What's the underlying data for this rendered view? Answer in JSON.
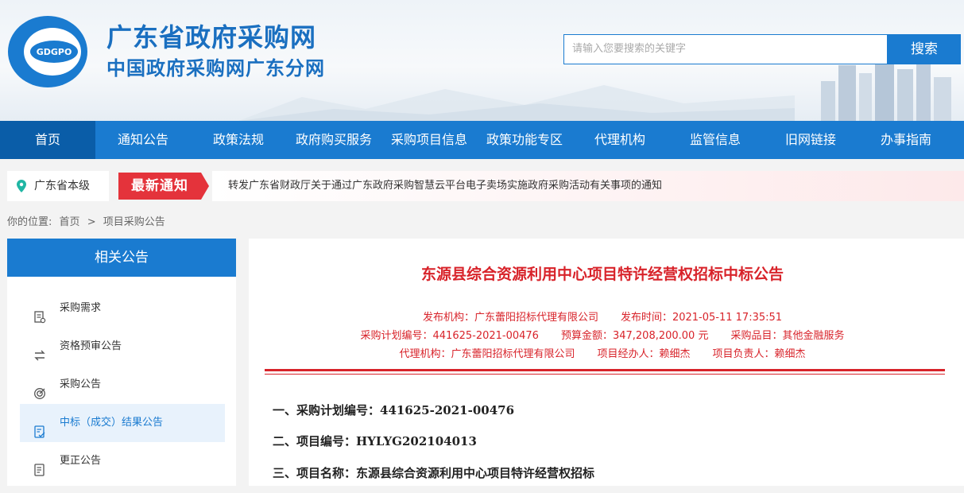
{
  "header": {
    "site_title": "广东省政府采购网",
    "site_subtitle": "中国政府采购网广东分网",
    "logo_text": "GDGPO",
    "search_placeholder": "请输入您要搜索的关键字",
    "search_button": "搜索"
  },
  "nav": {
    "items": [
      "首页",
      "通知公告",
      "政策法规",
      "政府购买服务",
      "采购项目信息",
      "政策功能专区",
      "代理机构",
      "监管信息",
      "旧网链接",
      "办事指南"
    ],
    "active_index": 0
  },
  "notice": {
    "location": "广东省本级",
    "badge": "最新通知",
    "text": "转发广东省财政厅关于通过广东政府采购智慧云平台电子卖场实施政府采购活动有关事项的通知"
  },
  "breadcrumb": {
    "prefix": "你的位置:",
    "home": "首页",
    "sep": ">",
    "current": "项目采购公告"
  },
  "sidebar": {
    "title": "相关公告",
    "items": [
      {
        "label": "采购需求",
        "icon": "document-list-icon"
      },
      {
        "label": "资格预审公告",
        "icon": "swap-arrows-icon"
      },
      {
        "label": "采购公告",
        "icon": "target-icon"
      },
      {
        "label": "中标（成交）结果公告",
        "icon": "document-check-icon"
      },
      {
        "label": "更正公告",
        "icon": "document-edit-icon"
      }
    ],
    "active_index": 3
  },
  "article": {
    "title": "东源县综合资源利用中心项目特许经营权招标中标公告",
    "meta1": [
      "发布机构：广东蕾阳招标代理有限公司",
      "发布时间：2021-05-11 17:35:51"
    ],
    "meta2": [
      "采购计划编号：441625-2021-00476",
      "预算金额：347,208,200.00 元",
      "采购品目：其他金融服务"
    ],
    "meta3": [
      "代理机构：广东蕾阳招标代理有限公司",
      "项目经办人：赖细杰",
      "项目负责人：赖细杰"
    ],
    "paragraphs": [
      "一、采购计划编号：441625-2021-00476",
      "二、项目编号：HYLYG202104013",
      "三、项目名称：东源县综合资源利用中心项目特许经营权招标"
    ]
  },
  "colors": {
    "primary": "#1a7bd0",
    "nav_active": "#0a5da8",
    "accent_red": "#d8232a",
    "badge_red": "#e4333b"
  }
}
